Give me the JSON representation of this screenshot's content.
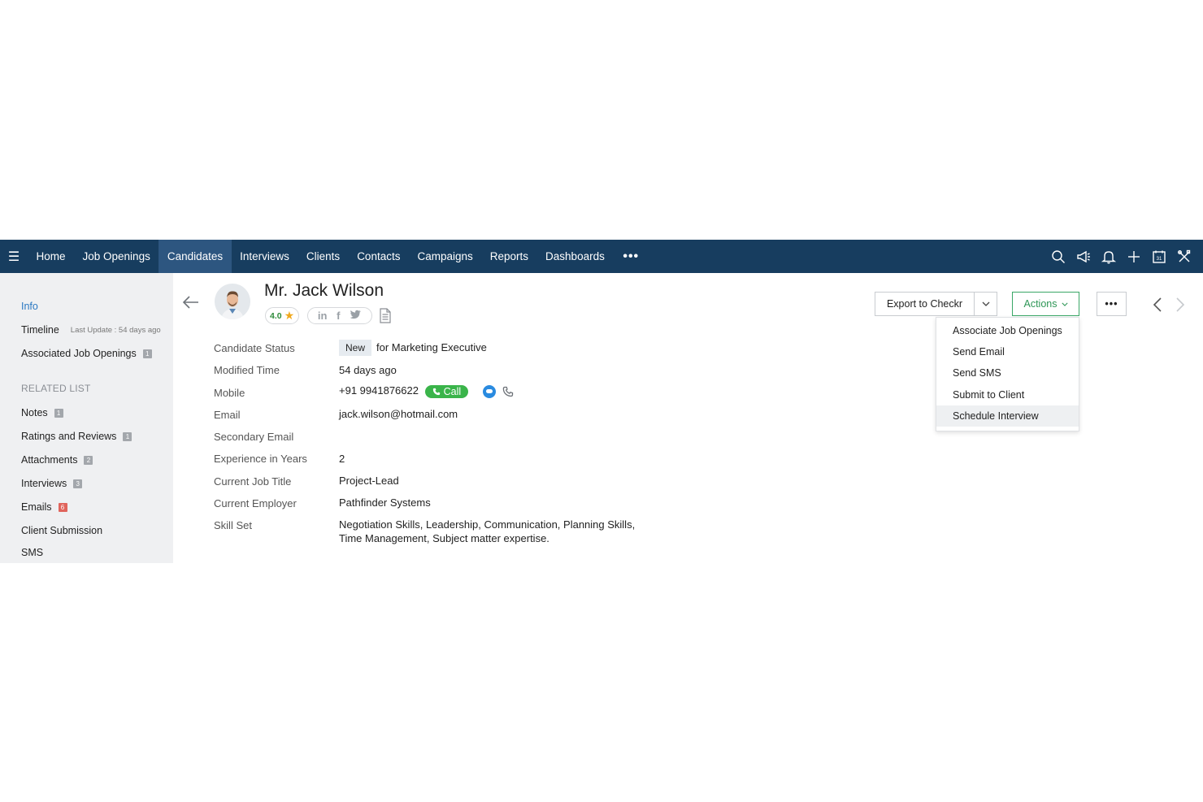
{
  "nav": {
    "tabs": [
      "Home",
      "Job Openings",
      "Candidates",
      "Interviews",
      "Clients",
      "Contacts",
      "Campaigns",
      "Reports",
      "Dashboards"
    ],
    "active_tab": "Candidates",
    "more": "•••",
    "icons": [
      "search-icon",
      "megaphone-icon",
      "bell-icon",
      "plus-icon",
      "calendar-icon",
      "tools-icon"
    ],
    "calendar_day": "31"
  },
  "sidebar": {
    "info": "Info",
    "timeline": "Timeline",
    "last_update": "Last Update : 54 days ago",
    "associated_job_openings": "Associated Job Openings",
    "associated_job_openings_count": "1",
    "related_list_title": "RELATED LIST",
    "related": [
      {
        "label": "Notes",
        "count": "1"
      },
      {
        "label": "Ratings and Reviews",
        "count": "1"
      },
      {
        "label": "Attachments",
        "count": "2"
      },
      {
        "label": "Interviews",
        "count": "3"
      },
      {
        "label": "Emails",
        "count": "6"
      },
      {
        "label": "Client Submission",
        "count": ""
      },
      {
        "label": "SMS",
        "count": ""
      }
    ]
  },
  "candidate": {
    "name": "Mr. Jack Wilson",
    "rating": "4.0",
    "social": [
      "in",
      "f",
      "t"
    ],
    "fields": {
      "status_label": "Candidate Status",
      "status_chip": "New",
      "status_text": "for Marketing Executive",
      "modified_label": "Modified Time",
      "modified_value": "54 days ago",
      "mobile_label": "Mobile",
      "mobile_value": "+91 9941876622",
      "call_label": "Call",
      "email_label": "Email",
      "email_value": "jack.wilson@hotmail.com",
      "secondary_email_label": "Secondary Email",
      "experience_label": "Experience in Years",
      "experience_value": "2",
      "job_title_label": "Current Job Title",
      "job_title_value": "Project-Lead",
      "employer_label": "Current Employer",
      "employer_value": "Pathfinder Systems",
      "skill_label": "Skill Set",
      "skill_line1": "Negotiation Skills, Leadership, Communication, Planning Skills,",
      "skill_line2": "Time Management, Subject matter expertise."
    }
  },
  "toolbar": {
    "export_label": "Export to Checkr",
    "actions_label": "Actions",
    "more_label": "•••"
  },
  "actions_menu": [
    "Associate Job Openings",
    "Send Email",
    "Send SMS",
    "Submit to Client",
    "Schedule Interview"
  ],
  "colors": {
    "nav_bg": "#173d5f",
    "nav_active": "#2d5680",
    "sidebar_bg": "#eff0f2",
    "link_blue": "#2a78c2",
    "action_green": "#2e9656",
    "call_green": "#3ab44a",
    "badge_red": "#e0645c"
  }
}
